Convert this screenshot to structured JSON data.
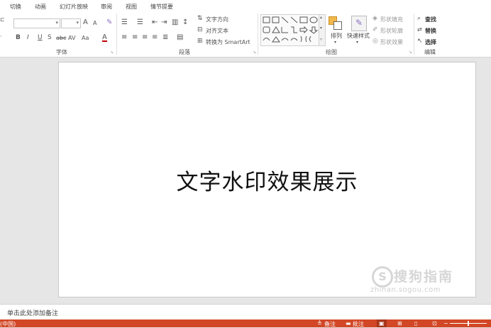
{
  "tabs": [
    "切换",
    "动画",
    "幻灯片放映",
    "审阅",
    "视图",
    "情节提要"
  ],
  "ribbon": {
    "font": {
      "group_label": "字体",
      "bold": "B",
      "italic": "I",
      "underline": "U",
      "shadow": "S",
      "strike": "abc",
      "spacing": "AV",
      "case": "Aa",
      "color": "A",
      "grow": "A",
      "shrink": "A"
    },
    "paragraph": {
      "group_label": "段落",
      "text_direction": "文字方向",
      "align_text": "对齐文本",
      "smartart": "转换为 SmartArt"
    },
    "drawing": {
      "group_label": "绘图",
      "arrange": "排列",
      "quick_styles": "快速样式",
      "shape_fill": "形状填充",
      "shape_outline": "形状轮廓",
      "shape_effects": "形状效果"
    },
    "editing": {
      "group_label": "编辑",
      "find": "查找",
      "replace": "替换",
      "select": "选择"
    }
  },
  "slide": {
    "text": "文字水印效果展示"
  },
  "notes": {
    "placeholder": "单击此处添加备注"
  },
  "statusbar": {
    "language": "(中国)",
    "notes_btn": "备注",
    "comments_btn": "批注"
  },
  "watermark": {
    "mark": "S",
    "title": "搜狗指南",
    "url": "zhinan.sogou.com"
  },
  "colors": {
    "status_bar": "#d24726",
    "ribbon_bg": "#ffffff",
    "workspace_bg": "#e6e6e6"
  }
}
